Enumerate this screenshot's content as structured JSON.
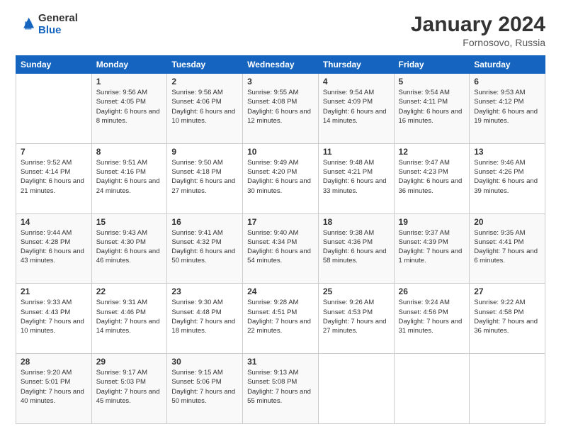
{
  "logo": {
    "general": "General",
    "blue": "Blue"
  },
  "header": {
    "month": "January 2024",
    "location": "Fornosovo, Russia"
  },
  "days_of_week": [
    "Sunday",
    "Monday",
    "Tuesday",
    "Wednesday",
    "Thursday",
    "Friday",
    "Saturday"
  ],
  "weeks": [
    [
      {
        "day": "",
        "sunrise": "",
        "sunset": "",
        "daylight": ""
      },
      {
        "day": "1",
        "sunrise": "Sunrise: 9:56 AM",
        "sunset": "Sunset: 4:05 PM",
        "daylight": "Daylight: 6 hours and 8 minutes."
      },
      {
        "day": "2",
        "sunrise": "Sunrise: 9:56 AM",
        "sunset": "Sunset: 4:06 PM",
        "daylight": "Daylight: 6 hours and 10 minutes."
      },
      {
        "day": "3",
        "sunrise": "Sunrise: 9:55 AM",
        "sunset": "Sunset: 4:08 PM",
        "daylight": "Daylight: 6 hours and 12 minutes."
      },
      {
        "day": "4",
        "sunrise": "Sunrise: 9:54 AM",
        "sunset": "Sunset: 4:09 PM",
        "daylight": "Daylight: 6 hours and 14 minutes."
      },
      {
        "day": "5",
        "sunrise": "Sunrise: 9:54 AM",
        "sunset": "Sunset: 4:11 PM",
        "daylight": "Daylight: 6 hours and 16 minutes."
      },
      {
        "day": "6",
        "sunrise": "Sunrise: 9:53 AM",
        "sunset": "Sunset: 4:12 PM",
        "daylight": "Daylight: 6 hours and 19 minutes."
      }
    ],
    [
      {
        "day": "7",
        "sunrise": "Sunrise: 9:52 AM",
        "sunset": "Sunset: 4:14 PM",
        "daylight": "Daylight: 6 hours and 21 minutes."
      },
      {
        "day": "8",
        "sunrise": "Sunrise: 9:51 AM",
        "sunset": "Sunset: 4:16 PM",
        "daylight": "Daylight: 6 hours and 24 minutes."
      },
      {
        "day": "9",
        "sunrise": "Sunrise: 9:50 AM",
        "sunset": "Sunset: 4:18 PM",
        "daylight": "Daylight: 6 hours and 27 minutes."
      },
      {
        "day": "10",
        "sunrise": "Sunrise: 9:49 AM",
        "sunset": "Sunset: 4:20 PM",
        "daylight": "Daylight: 6 hours and 30 minutes."
      },
      {
        "day": "11",
        "sunrise": "Sunrise: 9:48 AM",
        "sunset": "Sunset: 4:21 PM",
        "daylight": "Daylight: 6 hours and 33 minutes."
      },
      {
        "day": "12",
        "sunrise": "Sunrise: 9:47 AM",
        "sunset": "Sunset: 4:23 PM",
        "daylight": "Daylight: 6 hours and 36 minutes."
      },
      {
        "day": "13",
        "sunrise": "Sunrise: 9:46 AM",
        "sunset": "Sunset: 4:26 PM",
        "daylight": "Daylight: 6 hours and 39 minutes."
      }
    ],
    [
      {
        "day": "14",
        "sunrise": "Sunrise: 9:44 AM",
        "sunset": "Sunset: 4:28 PM",
        "daylight": "Daylight: 6 hours and 43 minutes."
      },
      {
        "day": "15",
        "sunrise": "Sunrise: 9:43 AM",
        "sunset": "Sunset: 4:30 PM",
        "daylight": "Daylight: 6 hours and 46 minutes."
      },
      {
        "day": "16",
        "sunrise": "Sunrise: 9:41 AM",
        "sunset": "Sunset: 4:32 PM",
        "daylight": "Daylight: 6 hours and 50 minutes."
      },
      {
        "day": "17",
        "sunrise": "Sunrise: 9:40 AM",
        "sunset": "Sunset: 4:34 PM",
        "daylight": "Daylight: 6 hours and 54 minutes."
      },
      {
        "day": "18",
        "sunrise": "Sunrise: 9:38 AM",
        "sunset": "Sunset: 4:36 PM",
        "daylight": "Daylight: 6 hours and 58 minutes."
      },
      {
        "day": "19",
        "sunrise": "Sunrise: 9:37 AM",
        "sunset": "Sunset: 4:39 PM",
        "daylight": "Daylight: 7 hours and 1 minute."
      },
      {
        "day": "20",
        "sunrise": "Sunrise: 9:35 AM",
        "sunset": "Sunset: 4:41 PM",
        "daylight": "Daylight: 7 hours and 6 minutes."
      }
    ],
    [
      {
        "day": "21",
        "sunrise": "Sunrise: 9:33 AM",
        "sunset": "Sunset: 4:43 PM",
        "daylight": "Daylight: 7 hours and 10 minutes."
      },
      {
        "day": "22",
        "sunrise": "Sunrise: 9:31 AM",
        "sunset": "Sunset: 4:46 PM",
        "daylight": "Daylight: 7 hours and 14 minutes."
      },
      {
        "day": "23",
        "sunrise": "Sunrise: 9:30 AM",
        "sunset": "Sunset: 4:48 PM",
        "daylight": "Daylight: 7 hours and 18 minutes."
      },
      {
        "day": "24",
        "sunrise": "Sunrise: 9:28 AM",
        "sunset": "Sunset: 4:51 PM",
        "daylight": "Daylight: 7 hours and 22 minutes."
      },
      {
        "day": "25",
        "sunrise": "Sunrise: 9:26 AM",
        "sunset": "Sunset: 4:53 PM",
        "daylight": "Daylight: 7 hours and 27 minutes."
      },
      {
        "day": "26",
        "sunrise": "Sunrise: 9:24 AM",
        "sunset": "Sunset: 4:56 PM",
        "daylight": "Daylight: 7 hours and 31 minutes."
      },
      {
        "day": "27",
        "sunrise": "Sunrise: 9:22 AM",
        "sunset": "Sunset: 4:58 PM",
        "daylight": "Daylight: 7 hours and 36 minutes."
      }
    ],
    [
      {
        "day": "28",
        "sunrise": "Sunrise: 9:20 AM",
        "sunset": "Sunset: 5:01 PM",
        "daylight": "Daylight: 7 hours and 40 minutes."
      },
      {
        "day": "29",
        "sunrise": "Sunrise: 9:17 AM",
        "sunset": "Sunset: 5:03 PM",
        "daylight": "Daylight: 7 hours and 45 minutes."
      },
      {
        "day": "30",
        "sunrise": "Sunrise: 9:15 AM",
        "sunset": "Sunset: 5:06 PM",
        "daylight": "Daylight: 7 hours and 50 minutes."
      },
      {
        "day": "31",
        "sunrise": "Sunrise: 9:13 AM",
        "sunset": "Sunset: 5:08 PM",
        "daylight": "Daylight: 7 hours and 55 minutes."
      },
      {
        "day": "",
        "sunrise": "",
        "sunset": "",
        "daylight": ""
      },
      {
        "day": "",
        "sunrise": "",
        "sunset": "",
        "daylight": ""
      },
      {
        "day": "",
        "sunrise": "",
        "sunset": "",
        "daylight": ""
      }
    ]
  ]
}
